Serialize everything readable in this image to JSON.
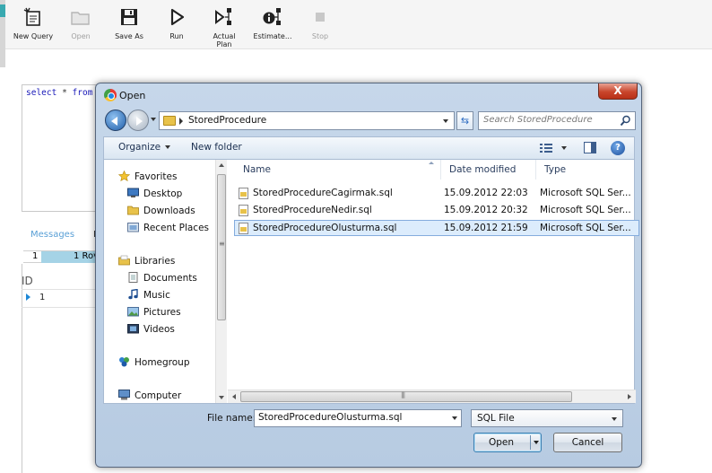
{
  "toolbar": {
    "buttons": [
      {
        "label": "New Query",
        "icon": "new-query-icon",
        "enabled": true
      },
      {
        "label": "Open",
        "icon": "open-folder-icon",
        "enabled": false
      },
      {
        "label": "Save As",
        "icon": "save-icon",
        "enabled": true
      },
      {
        "label": "Run",
        "icon": "run-icon",
        "enabled": true
      },
      {
        "label": "Actual Plan",
        "icon": "plan-icon",
        "enabled": true
      },
      {
        "label": "Estimate...",
        "icon": "estimate-plan-icon",
        "enabled": true
      },
      {
        "label": "Stop",
        "icon": "stop-icon",
        "enabled": false
      }
    ]
  },
  "editor": {
    "code_keyword1": "select",
    "code_op": "*",
    "code_keyword2": "from"
  },
  "results": {
    "tab_messages": "Messages",
    "tab_results_partial": "R",
    "status_num": "1",
    "status_text": "1 Rov",
    "column_header": "ID",
    "row_value": "1"
  },
  "dialog": {
    "title": "Open",
    "close_label": "X",
    "address_path": "StoredProcedure",
    "search_placeholder": "Search StoredProcedure",
    "commands": {
      "organize": "Organize",
      "new_folder": "New folder",
      "help": "?"
    },
    "nav_items": [
      {
        "label": "Favorites",
        "icon": "star-icon",
        "level": 0
      },
      {
        "label": "Desktop",
        "icon": "desktop-icon",
        "level": 1
      },
      {
        "label": "Downloads",
        "icon": "downloads-folder-icon",
        "level": 1
      },
      {
        "label": "Recent Places",
        "icon": "recent-places-icon",
        "level": 1
      },
      {
        "label": "Libraries",
        "icon": "libraries-icon",
        "level": 0
      },
      {
        "label": "Documents",
        "icon": "documents-icon",
        "level": 1
      },
      {
        "label": "Music",
        "icon": "music-icon",
        "level": 1
      },
      {
        "label": "Pictures",
        "icon": "pictures-icon",
        "level": 1
      },
      {
        "label": "Videos",
        "icon": "videos-icon",
        "level": 1
      },
      {
        "label": "Homegroup",
        "icon": "homegroup-icon",
        "level": 0
      },
      {
        "label": "Computer",
        "icon": "computer-icon",
        "level": 0
      }
    ],
    "columns": {
      "name": "Name",
      "date": "Date modified",
      "type": "Type"
    },
    "files": [
      {
        "name": "StoredProcedureCagirmak.sql",
        "date": "15.09.2012 22:03",
        "type": "Microsoft SQL Ser...",
        "selected": false
      },
      {
        "name": "StoredProcedureNedir.sql",
        "date": "15.09.2012 20:32",
        "type": "Microsoft SQL Ser...",
        "selected": false
      },
      {
        "name": "StoredProcedureOlusturma.sql",
        "date": "15.09.2012 21:59",
        "type": "Microsoft SQL Ser...",
        "selected": true
      }
    ],
    "file_name_label": "File name:",
    "file_name_value": "StoredProcedureOlusturma.sql",
    "file_type": "SQL File",
    "open_button": "Open",
    "cancel_button": "Cancel"
  },
  "colors": {
    "selection_bg": "#dcecfc",
    "selection_border": "#84acdd",
    "dialog_frame": "#c6d7ea",
    "close_red": "#c8452b",
    "editor_keyword": "#1818b8"
  }
}
